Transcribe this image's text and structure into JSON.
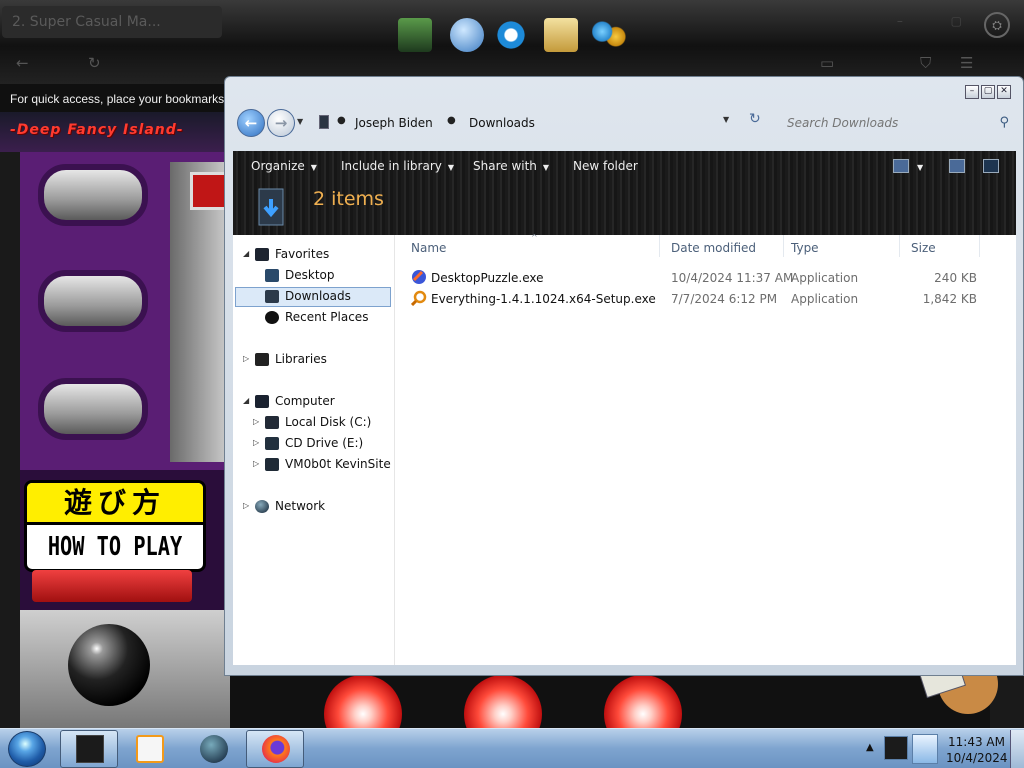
{
  "background": {
    "browser_tab_title": "2. Super Casual Ma...",
    "bookmarks_hint": "For quick access, place your bookmarks here",
    "game": {
      "logo_text": "-Deep Fancy Island-",
      "howto_jp": "遊び方",
      "howto_en": "HOW TO PLAY"
    }
  },
  "explorer": {
    "breadcrumbs": [
      "Joseph Biden",
      "Downloads"
    ],
    "search_placeholder": "Search Downloads",
    "toolbar": {
      "organize": "Organize",
      "include_in_library": "Include in library",
      "share_with": "Share with",
      "new_folder": "New folder"
    },
    "items_count": "2 items",
    "nav": {
      "favorites": "Favorites",
      "desktop": "Desktop",
      "downloads": "Downloads",
      "recent_places": "Recent Places",
      "libraries": "Libraries",
      "computer": "Computer",
      "local_disk": "Local Disk (C:)",
      "cd_drive": "CD Drive (E:)",
      "network_share": "VM0b0t KevinSite",
      "network": "Network"
    },
    "columns": {
      "name": "Name",
      "date_modified": "Date modified",
      "type": "Type",
      "size": "Size"
    },
    "files": [
      {
        "name": "DesktopPuzzle.exe",
        "date": "10/4/2024 11:37 AM",
        "type": "Application",
        "size": "240 KB",
        "icon": "puzzle-app-icon"
      },
      {
        "name": "Everything-1.4.1.1024.x64-Setup.exe",
        "date": "7/7/2024 6:12 PM",
        "type": "Application",
        "size": "1,842 KB",
        "icon": "magnifier-setup-icon"
      }
    ]
  },
  "taskbar": {
    "time": "11:43 AM",
    "date": "10/4/2024"
  },
  "colors": {
    "accent": "#4a6a98",
    "items_count": "#f0b050",
    "selection": "#dbe9f8"
  }
}
